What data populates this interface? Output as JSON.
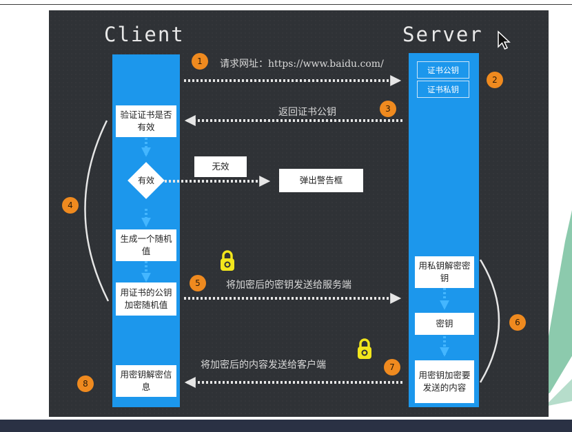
{
  "diagram": {
    "client_title": "Client",
    "server_title": "Server",
    "steps": {
      "n1": "1",
      "n2": "2",
      "n3": "3",
      "n4": "4",
      "n5": "5",
      "n6": "6",
      "n7": "7",
      "n8": "8"
    },
    "arrow_labels": {
      "request_url": "请求网址：https://www.baidu.com/",
      "return_cert_pubkey": "返回证书公钥",
      "invalid": "无效",
      "send_encrypted_key": "将加密后的密钥发送给服务端",
      "send_encrypted_content": "将加密后的内容发送给客户端"
    },
    "client_boxes": {
      "verify_cert": "验证证书是否有效",
      "valid_decision": "有效",
      "gen_random": "生成一个随机值",
      "encrypt_random": "用证书的公钥加密随机值",
      "decrypt_info": "用密钥解密信息"
    },
    "server_boxes": {
      "cert_pubkey": "证书公钥",
      "cert_privkey": "证书私钥",
      "decrypt_key": "用私钥解密密钥",
      "key": "密钥",
      "encrypt_content": "用密钥加密要发送的内容"
    },
    "alert_box": "弹出警告框",
    "colors": {
      "board": "#2f3236",
      "column": "#1c97ec",
      "badge": "#ef8a1f",
      "lock": "#f2e61c",
      "watermark": "#2e9e6a"
    }
  }
}
